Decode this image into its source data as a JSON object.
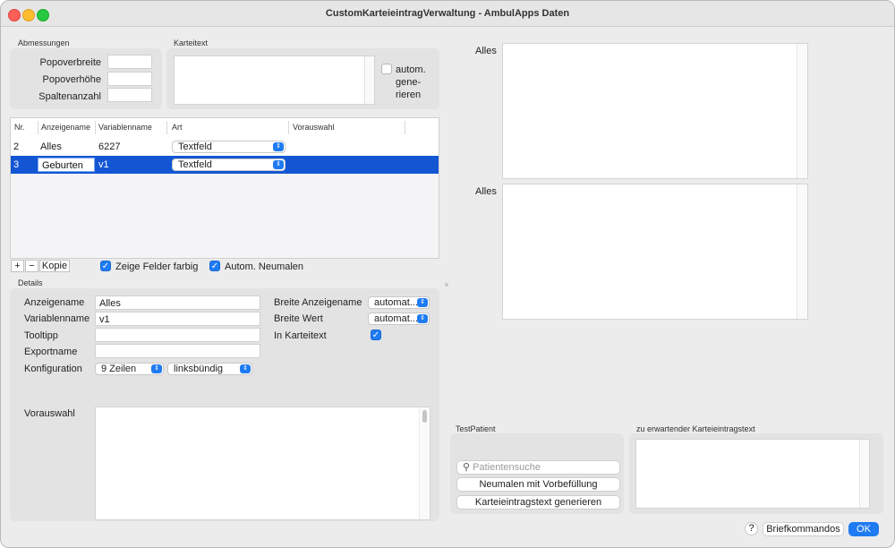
{
  "window": {
    "title": "CustomKarteieintragVerwaltung - AmbulApps Daten"
  },
  "abmessungen": {
    "group_label": "Abmessungen",
    "popoverbreite_label": "Popoverbreite",
    "popoverhoehe_label": "Popoverhöhe",
    "spaltenanzahl_label": "Spaltenanzahl",
    "popoverbreite_value": "",
    "popoverhoehe_value": "",
    "spaltenanzahl_value": ""
  },
  "karteitext": {
    "group_label": "Karteitext",
    "value": "",
    "autom_label_1": "autom.",
    "autom_label_2": "gene-",
    "autom_label_3": "rieren",
    "autom_checked": false
  },
  "table": {
    "headers": [
      "Nr.",
      "Anzeigename",
      "Variablenname",
      "Art",
      "Vorauswahl"
    ],
    "rows": [
      {
        "nr": "2",
        "anzeigename": "Alles",
        "variablenname": "6227",
        "art": "Textfeld",
        "vorauswahl": "",
        "selected": false
      },
      {
        "nr": "3",
        "anzeigename": "Geburten",
        "variablenname": "v1",
        "art": "Textfeld",
        "vorauswahl": "",
        "selected": true
      }
    ]
  },
  "table_controls": {
    "add": "+",
    "remove": "−",
    "copy": "Kopie",
    "zeige_farbig_label": "Zeige Felder farbig",
    "zeige_farbig_checked": true,
    "autom_neumalen_label": "Autom. Neumalen",
    "autom_neumalen_checked": true
  },
  "details": {
    "group_label": "Details",
    "anzeigename_label": "Anzeigename",
    "anzeigename_value": "Alles",
    "variablenname_label": "Variablenname",
    "variablenname_value": "v1",
    "tooltipp_label": "Tooltipp",
    "tooltipp_value": "",
    "exportname_label": "Exportname",
    "exportname_value": "",
    "konfiguration_label": "Konfiguration",
    "zeilen_value": "9 Zeilen",
    "ausrichtung_value": "linksbündig",
    "breite_anzeigename_label": "Breite Anzeigename",
    "breite_anzeigename_value": "automat...",
    "breite_wert_label": "Breite Wert",
    "breite_wert_value": "automat...",
    "in_karteitext_label": "In Karteitext",
    "in_karteitext_checked": true,
    "vorauswahl_label": "Vorauswahl",
    "vorauswahl_value": ""
  },
  "preview": {
    "label_1": "Alles",
    "label_2": "Alles"
  },
  "testpatient": {
    "group_label": "TestPatient",
    "search_placeholder": "Patientensuche",
    "neumalen_button": "Neumalen mit Vorbefüllung",
    "generieren_button": "Karteieintragstext generieren"
  },
  "expected": {
    "group_label": "zu erwartender Karteieintragstext",
    "value": ""
  },
  "footer": {
    "help": "?",
    "briefkommandos": "Briefkommandos",
    "ok": "OK"
  },
  "colors": {
    "accent": "#1f7bf2",
    "selection": "#1356d4"
  }
}
